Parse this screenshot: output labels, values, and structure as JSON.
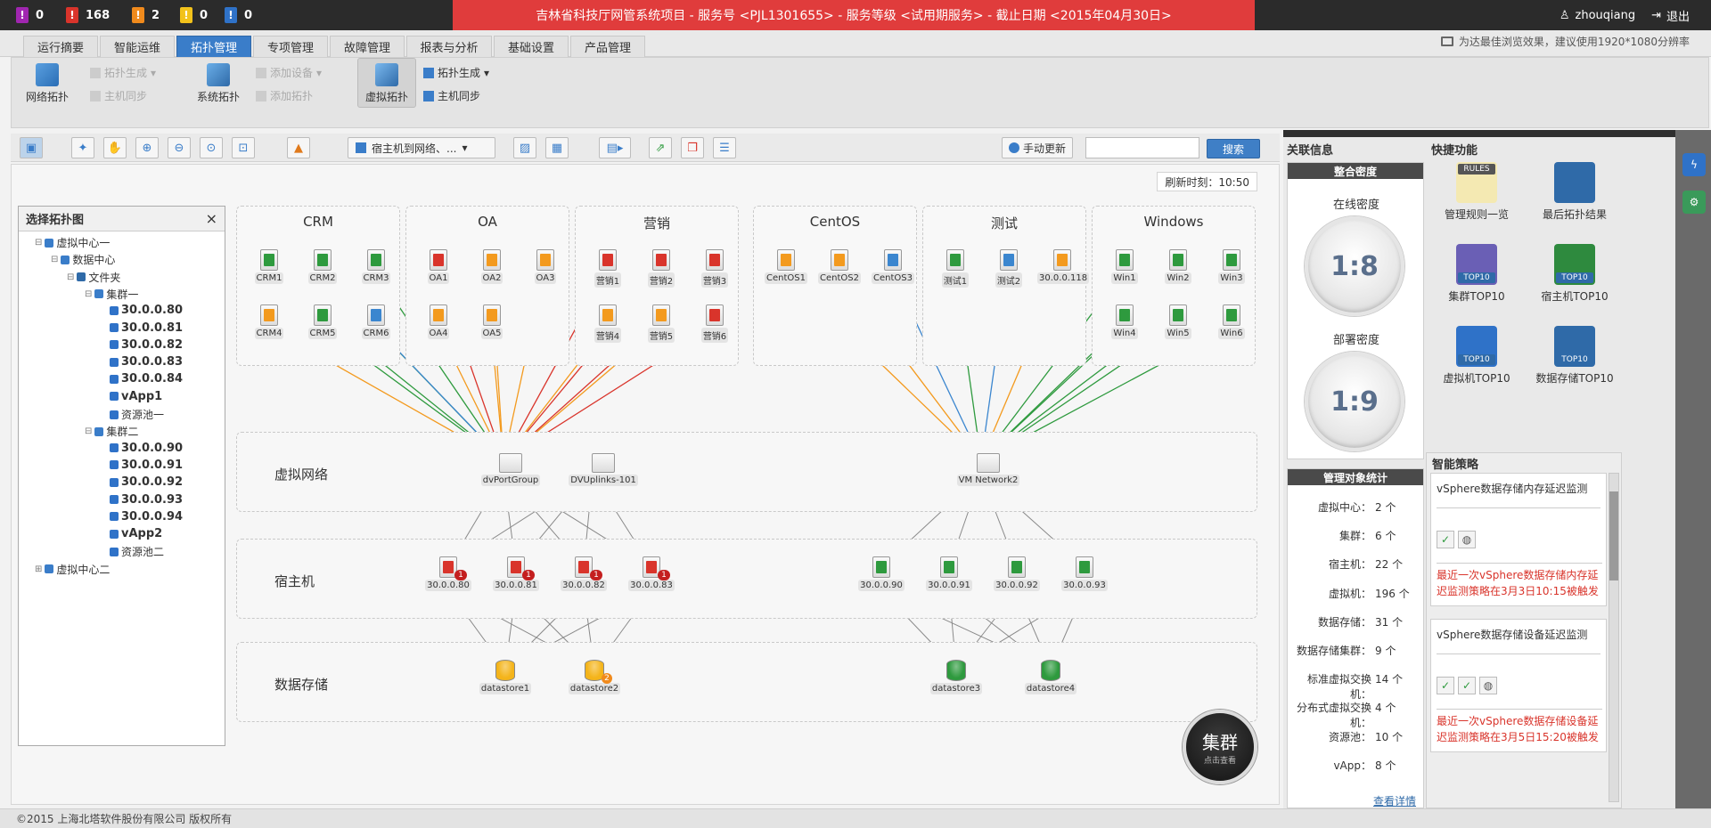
{
  "alerts": [
    {
      "value": "0",
      "color": "#a026b0",
      "glyph": "!"
    },
    {
      "value": "168",
      "color": "#d9342b",
      "glyph": "!"
    },
    {
      "value": "2",
      "color": "#f08a1c",
      "glyph": "!"
    },
    {
      "value": "0",
      "color": "#f2c21b",
      "glyph": "!"
    },
    {
      "value": "0",
      "color": "#2f72c8",
      "glyph": "!"
    }
  ],
  "project_banner": "吉林省科技厅网管系统项目 - 服务号 <PJL1301655> - 服务等级 <试用期服务> - 截止日期 <2015年04月30日>",
  "user": {
    "name": "zhouqiang",
    "logout": "退出"
  },
  "tabs": [
    "运行摘要",
    "智能运维",
    "拓扑管理",
    "专项管理",
    "故障管理",
    "报表与分析",
    "基础设置",
    "产品管理"
  ],
  "resolution_hint": "为达最佳浏览效果，建议使用1920*1080分辨率",
  "ribbon": {
    "network_topo": "网络拓扑",
    "topo_gen_disabled": "拓扑生成",
    "host_sync_disabled": "主机同步",
    "system_topo": "系统拓扑",
    "add_device": "添加设备",
    "add_topo": "添加拓扑",
    "virtual_topo": "虚拟拓扑",
    "topo_gen": "拓扑生成",
    "host_sync": "主机同步"
  },
  "toolbar": {
    "dropdown": "宿主机到网络、...",
    "manual_update": "手动更新",
    "search_placeholder": "",
    "search_button": "搜索"
  },
  "refresh_time": "刷新时刻：10:50",
  "left_panel": {
    "title": "选择拓扑图",
    "close": "×",
    "tree": [
      {
        "label": "虚拟中心一",
        "level": 0,
        "bold": false
      },
      {
        "label": "数据中心",
        "level": 1,
        "bold": false
      },
      {
        "label": "文件夹",
        "level": 2,
        "bold": false
      },
      {
        "label": "集群一",
        "level": 3,
        "bold": false
      },
      {
        "label": "30.0.0.80",
        "level": 4,
        "bold": true
      },
      {
        "label": "30.0.0.81",
        "level": 4,
        "bold": true
      },
      {
        "label": "30.0.0.82",
        "level": 4,
        "bold": true
      },
      {
        "label": "30.0.0.83",
        "level": 4,
        "bold": true
      },
      {
        "label": "30.0.0.84",
        "level": 4,
        "bold": true
      },
      {
        "label": "vApp1",
        "level": 4,
        "bold": true
      },
      {
        "label": "资源池一",
        "level": 4,
        "bold": false
      },
      {
        "label": "集群二",
        "level": 3,
        "bold": false
      },
      {
        "label": "30.0.0.90",
        "level": 4,
        "bold": true
      },
      {
        "label": "30.0.0.91",
        "level": 4,
        "bold": true
      },
      {
        "label": "30.0.0.92",
        "level": 4,
        "bold": true
      },
      {
        "label": "30.0.0.93",
        "level": 4,
        "bold": true
      },
      {
        "label": "30.0.0.94",
        "level": 4,
        "bold": true
      },
      {
        "label": "vApp2",
        "level": 4,
        "bold": true
      },
      {
        "label": "资源池二",
        "level": 4,
        "bold": false
      },
      {
        "label": "虚拟中心二",
        "level": 0,
        "bold": false
      }
    ]
  },
  "groups": [
    {
      "title": "CRM",
      "vms": [
        {
          "name": "CRM1",
          "color": "#2e9a3e"
        },
        {
          "name": "CRM2",
          "color": "#2e9a3e"
        },
        {
          "name": "CRM3",
          "color": "#2e9a3e"
        },
        {
          "name": "CRM4",
          "color": "#f39a1e"
        },
        {
          "name": "CRM5",
          "color": "#2e9a3e"
        },
        {
          "name": "CRM6",
          "color": "#3b86cf"
        }
      ]
    },
    {
      "title": "OA",
      "vms": [
        {
          "name": "OA1",
          "color": "#d9342b"
        },
        {
          "name": "OA2",
          "color": "#f39a1e"
        },
        {
          "name": "OA3",
          "color": "#f39a1e"
        },
        {
          "name": "OA4",
          "color": "#f39a1e"
        },
        {
          "name": "OA5",
          "color": "#f39a1e"
        }
      ]
    },
    {
      "title": "营销",
      "vms": [
        {
          "name": "营销1",
          "color": "#d9342b"
        },
        {
          "name": "营销2",
          "color": "#d9342b"
        },
        {
          "name": "营销3",
          "color": "#d9342b"
        },
        {
          "name": "营销4",
          "color": "#f39a1e"
        },
        {
          "name": "营销5",
          "color": "#f39a1e"
        },
        {
          "name": "营销6",
          "color": "#d9342b"
        }
      ]
    },
    {
      "title": "CentOS",
      "vms": [
        {
          "name": "CentOS1",
          "color": "#f39a1e"
        },
        {
          "name": "CentOS2",
          "color": "#f39a1e"
        },
        {
          "name": "CentOS3",
          "color": "#3b86cf"
        }
      ]
    },
    {
      "title": "测试",
      "vms": [
        {
          "name": "测试1",
          "color": "#2e9a3e"
        },
        {
          "name": "测试2",
          "color": "#3b86cf"
        },
        {
          "name": "30.0.0.118",
          "color": "#f39a1e"
        }
      ]
    },
    {
      "title": "Windows",
      "vms": [
        {
          "name": "Win1",
          "color": "#2e9a3e"
        },
        {
          "name": "Win2",
          "color": "#2e9a3e"
        },
        {
          "name": "Win3",
          "color": "#2e9a3e"
        },
        {
          "name": "Win4",
          "color": "#2e9a3e"
        },
        {
          "name": "Win5",
          "color": "#2e9a3e"
        },
        {
          "name": "Win6",
          "color": "#2e9a3e"
        }
      ]
    }
  ],
  "bands": {
    "network": "虚拟网络",
    "host": "宿主机",
    "storage": "数据存储"
  },
  "network_nodes": [
    "dvPortGroup",
    "DVUplinks-101",
    "VM Network2"
  ],
  "hosts": [
    {
      "name": "30.0.0.80",
      "color": "#d9342b",
      "badge": "1"
    },
    {
      "name": "30.0.0.81",
      "color": "#d9342b",
      "badge": "1"
    },
    {
      "name": "30.0.0.82",
      "color": "#d9342b",
      "badge": "1"
    },
    {
      "name": "30.0.0.83",
      "color": "#d9342b",
      "badge": "1"
    },
    {
      "name": "30.0.0.90",
      "color": "#2e9a3e",
      "badge": ""
    },
    {
      "name": "30.0.0.91",
      "color": "#2e9a3e",
      "badge": ""
    },
    {
      "name": "30.0.0.92",
      "color": "#2e9a3e",
      "badge": ""
    },
    {
      "name": "30.0.0.93",
      "color": "#2e9a3e",
      "badge": ""
    }
  ],
  "datastores": [
    {
      "name": "datastore1",
      "color": "#f4b41a",
      "badge": ""
    },
    {
      "name": "datastore2",
      "color": "#f4b41a",
      "badge": "2"
    },
    {
      "name": "datastore3",
      "color": "#2e9a3e",
      "badge": ""
    },
    {
      "name": "datastore4",
      "color": "#2e9a3e",
      "badge": ""
    }
  ],
  "cluster_button": {
    "title": "集群",
    "sub": "点击查看"
  },
  "assoc": {
    "title": "关联信息",
    "density_title": "整合密度",
    "online_label": "在线密度",
    "online_value": "1:8",
    "deploy_label": "部署密度",
    "deploy_value": "1:9"
  },
  "stats": {
    "title": "管理对象统计",
    "items": [
      {
        "label": "虚拟中心：",
        "value": "2 个"
      },
      {
        "label": "集群：",
        "value": "6 个"
      },
      {
        "label": "宿主机：",
        "value": "22 个"
      },
      {
        "label": "虚拟机：",
        "value": "196 个"
      },
      {
        "label": "数据存储：",
        "value": "31 个"
      },
      {
        "label": "数据存储集群：",
        "value": "9 个"
      },
      {
        "label": "标准虚拟交换机：",
        "value": "14 个"
      },
      {
        "label": "分布式虚拟交换机：",
        "value": "4 个"
      },
      {
        "label": "资源池：",
        "value": "10 个"
      },
      {
        "label": "vApp：",
        "value": "8 个"
      }
    ],
    "more": "查看详情"
  },
  "quick": {
    "title": "快捷功能",
    "items": [
      {
        "label": "管理规则一览",
        "badge": "RULES"
      },
      {
        "label": "最后拓扑结果",
        "badge": ""
      },
      {
        "label": "集群TOP10",
        "badge": "TOP10"
      },
      {
        "label": "宿主机TOP10",
        "badge": "TOP10"
      },
      {
        "label": "虚拟机TOP10",
        "badge": "TOP10"
      },
      {
        "label": "数据存储TOP10",
        "badge": "TOP10"
      }
    ]
  },
  "strategy": {
    "title": "智能策略",
    "items": [
      {
        "name": "vSphere数据存储内存延迟监测",
        "alert": "最近一次vSphere数据存储内存延迟监测策略在3月3日10:15被触发"
      },
      {
        "name": "vSphere数据存储设备延迟监测",
        "alert": "最近一次vSphere数据存储设备延迟监测策略在3月5日15:20被触发"
      }
    ]
  },
  "footer": "©2015 上海北塔软件股份有限公司 版权所有"
}
